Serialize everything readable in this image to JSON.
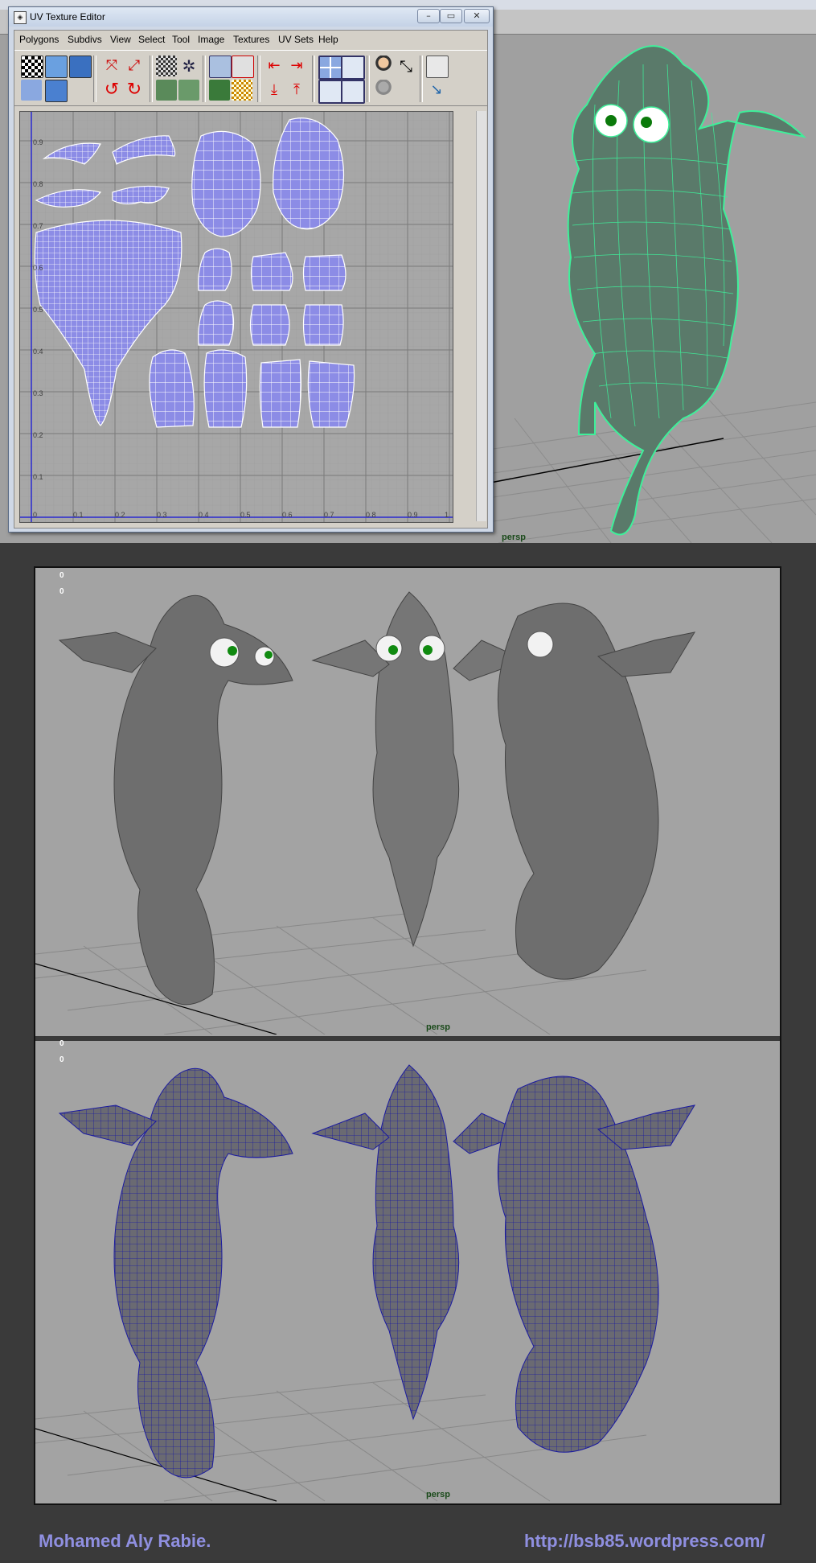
{
  "uv_editor": {
    "title": "UV Texture Editor",
    "menu": [
      "Polygons",
      "Subdivs",
      "View",
      "Select",
      "Tool",
      "Image",
      "Textures",
      "UV Sets",
      "Help"
    ],
    "window_buttons": {
      "minimize": "–",
      "restore": "▭",
      "close": "✕"
    },
    "axis_ticks_v": [
      "0.9",
      "0.8",
      "0.7",
      "0.6",
      "0.5",
      "0.4",
      "0.3",
      "0.2",
      "0.1"
    ],
    "axis_ticks_u": [
      "0",
      "0.1",
      "0.2",
      "0.3",
      "0.4",
      "0.5",
      "0.6",
      "0.7",
      "0.8",
      "0.9",
      "1"
    ],
    "toolbar_icons": [
      "checker-icon",
      "move-uv-icon",
      "flip-uv-icon",
      "rotate-left-icon",
      "rotate-right-icon",
      "unfold-icon",
      "layout-icon",
      "grid-snap-icon",
      "cut-uv-icon",
      "sew-uv-icon",
      "arrow-left-icon",
      "arrow-right-icon",
      "arrow-down-icon",
      "arrow-up-icon",
      "frame-all-icon",
      "frame-selected-icon",
      "image-display-icon",
      "uv-shell-icon",
      "user-icon",
      "pin-icon"
    ]
  },
  "viewport": {
    "top_label": "persp",
    "mid_label": "persp",
    "bottom_label": "persp",
    "hud_zero_top_1": "0",
    "hud_zero_top_2": "0",
    "hud_zero_bottom_1": "0",
    "hud_zero_bottom_2": "0"
  },
  "footer": {
    "author": "Mohamed Aly Rabie.",
    "url": "http://bsb85.wordpress.com/"
  },
  "colors": {
    "uv_shell_fill": "#8c8ce6",
    "wire_green": "#3ef09a",
    "wire_blue": "#1a1aa0",
    "footer_text": "#8f8fe0"
  }
}
